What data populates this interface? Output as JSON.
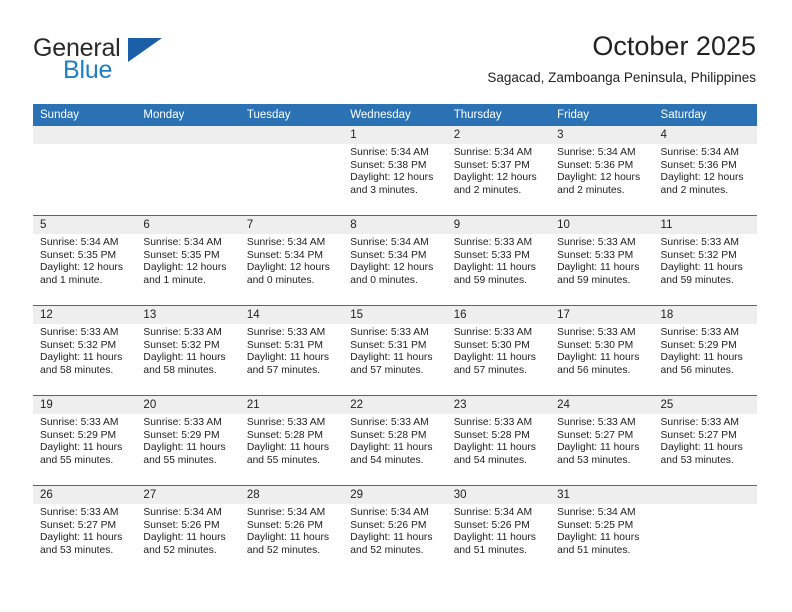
{
  "brand": {
    "word_one": "General",
    "word_two": "Blue",
    "triangle_color": "#1b5fa8",
    "blue_color": "#1f7fc4"
  },
  "header": {
    "title": "October 2025",
    "subtitle": "Sagacad, Zamboanga Peninsula, Philippines"
  },
  "theme": {
    "header_row_bg": "#2b72b5",
    "daynum_bg": "#eeeeee",
    "week_separator": "#2b72b5",
    "text": "#222222"
  },
  "weekdays": [
    "Sunday",
    "Monday",
    "Tuesday",
    "Wednesday",
    "Thursday",
    "Friday",
    "Saturday"
  ],
  "weeks": [
    [
      {
        "day": "",
        "sunrise": "",
        "sunset": "",
        "daylight1": "",
        "daylight2": ""
      },
      {
        "day": "",
        "sunrise": "",
        "sunset": "",
        "daylight1": "",
        "daylight2": ""
      },
      {
        "day": "",
        "sunrise": "",
        "sunset": "",
        "daylight1": "",
        "daylight2": ""
      },
      {
        "day": "1",
        "sunrise": "Sunrise: 5:34 AM",
        "sunset": "Sunset: 5:38 PM",
        "daylight1": "Daylight: 12 hours",
        "daylight2": "and 3 minutes."
      },
      {
        "day": "2",
        "sunrise": "Sunrise: 5:34 AM",
        "sunset": "Sunset: 5:37 PM",
        "daylight1": "Daylight: 12 hours",
        "daylight2": "and 2 minutes."
      },
      {
        "day": "3",
        "sunrise": "Sunrise: 5:34 AM",
        "sunset": "Sunset: 5:36 PM",
        "daylight1": "Daylight: 12 hours",
        "daylight2": "and 2 minutes."
      },
      {
        "day": "4",
        "sunrise": "Sunrise: 5:34 AM",
        "sunset": "Sunset: 5:36 PM",
        "daylight1": "Daylight: 12 hours",
        "daylight2": "and 2 minutes."
      }
    ],
    [
      {
        "day": "5",
        "sunrise": "Sunrise: 5:34 AM",
        "sunset": "Sunset: 5:35 PM",
        "daylight1": "Daylight: 12 hours",
        "daylight2": "and 1 minute."
      },
      {
        "day": "6",
        "sunrise": "Sunrise: 5:34 AM",
        "sunset": "Sunset: 5:35 PM",
        "daylight1": "Daylight: 12 hours",
        "daylight2": "and 1 minute."
      },
      {
        "day": "7",
        "sunrise": "Sunrise: 5:34 AM",
        "sunset": "Sunset: 5:34 PM",
        "daylight1": "Daylight: 12 hours",
        "daylight2": "and 0 minutes."
      },
      {
        "day": "8",
        "sunrise": "Sunrise: 5:34 AM",
        "sunset": "Sunset: 5:34 PM",
        "daylight1": "Daylight: 12 hours",
        "daylight2": "and 0 minutes."
      },
      {
        "day": "9",
        "sunrise": "Sunrise: 5:33 AM",
        "sunset": "Sunset: 5:33 PM",
        "daylight1": "Daylight: 11 hours",
        "daylight2": "and 59 minutes."
      },
      {
        "day": "10",
        "sunrise": "Sunrise: 5:33 AM",
        "sunset": "Sunset: 5:33 PM",
        "daylight1": "Daylight: 11 hours",
        "daylight2": "and 59 minutes."
      },
      {
        "day": "11",
        "sunrise": "Sunrise: 5:33 AM",
        "sunset": "Sunset: 5:32 PM",
        "daylight1": "Daylight: 11 hours",
        "daylight2": "and 59 minutes."
      }
    ],
    [
      {
        "day": "12",
        "sunrise": "Sunrise: 5:33 AM",
        "sunset": "Sunset: 5:32 PM",
        "daylight1": "Daylight: 11 hours",
        "daylight2": "and 58 minutes."
      },
      {
        "day": "13",
        "sunrise": "Sunrise: 5:33 AM",
        "sunset": "Sunset: 5:32 PM",
        "daylight1": "Daylight: 11 hours",
        "daylight2": "and 58 minutes."
      },
      {
        "day": "14",
        "sunrise": "Sunrise: 5:33 AM",
        "sunset": "Sunset: 5:31 PM",
        "daylight1": "Daylight: 11 hours",
        "daylight2": "and 57 minutes."
      },
      {
        "day": "15",
        "sunrise": "Sunrise: 5:33 AM",
        "sunset": "Sunset: 5:31 PM",
        "daylight1": "Daylight: 11 hours",
        "daylight2": "and 57 minutes."
      },
      {
        "day": "16",
        "sunrise": "Sunrise: 5:33 AM",
        "sunset": "Sunset: 5:30 PM",
        "daylight1": "Daylight: 11 hours",
        "daylight2": "and 57 minutes."
      },
      {
        "day": "17",
        "sunrise": "Sunrise: 5:33 AM",
        "sunset": "Sunset: 5:30 PM",
        "daylight1": "Daylight: 11 hours",
        "daylight2": "and 56 minutes."
      },
      {
        "day": "18",
        "sunrise": "Sunrise: 5:33 AM",
        "sunset": "Sunset: 5:29 PM",
        "daylight1": "Daylight: 11 hours",
        "daylight2": "and 56 minutes."
      }
    ],
    [
      {
        "day": "19",
        "sunrise": "Sunrise: 5:33 AM",
        "sunset": "Sunset: 5:29 PM",
        "daylight1": "Daylight: 11 hours",
        "daylight2": "and 55 minutes."
      },
      {
        "day": "20",
        "sunrise": "Sunrise: 5:33 AM",
        "sunset": "Sunset: 5:29 PM",
        "daylight1": "Daylight: 11 hours",
        "daylight2": "and 55 minutes."
      },
      {
        "day": "21",
        "sunrise": "Sunrise: 5:33 AM",
        "sunset": "Sunset: 5:28 PM",
        "daylight1": "Daylight: 11 hours",
        "daylight2": "and 55 minutes."
      },
      {
        "day": "22",
        "sunrise": "Sunrise: 5:33 AM",
        "sunset": "Sunset: 5:28 PM",
        "daylight1": "Daylight: 11 hours",
        "daylight2": "and 54 minutes."
      },
      {
        "day": "23",
        "sunrise": "Sunrise: 5:33 AM",
        "sunset": "Sunset: 5:28 PM",
        "daylight1": "Daylight: 11 hours",
        "daylight2": "and 54 minutes."
      },
      {
        "day": "24",
        "sunrise": "Sunrise: 5:33 AM",
        "sunset": "Sunset: 5:27 PM",
        "daylight1": "Daylight: 11 hours",
        "daylight2": "and 53 minutes."
      },
      {
        "day": "25",
        "sunrise": "Sunrise: 5:33 AM",
        "sunset": "Sunset: 5:27 PM",
        "daylight1": "Daylight: 11 hours",
        "daylight2": "and 53 minutes."
      }
    ],
    [
      {
        "day": "26",
        "sunrise": "Sunrise: 5:33 AM",
        "sunset": "Sunset: 5:27 PM",
        "daylight1": "Daylight: 11 hours",
        "daylight2": "and 53 minutes."
      },
      {
        "day": "27",
        "sunrise": "Sunrise: 5:34 AM",
        "sunset": "Sunset: 5:26 PM",
        "daylight1": "Daylight: 11 hours",
        "daylight2": "and 52 minutes."
      },
      {
        "day": "28",
        "sunrise": "Sunrise: 5:34 AM",
        "sunset": "Sunset: 5:26 PM",
        "daylight1": "Daylight: 11 hours",
        "daylight2": "and 52 minutes."
      },
      {
        "day": "29",
        "sunrise": "Sunrise: 5:34 AM",
        "sunset": "Sunset: 5:26 PM",
        "daylight1": "Daylight: 11 hours",
        "daylight2": "and 52 minutes."
      },
      {
        "day": "30",
        "sunrise": "Sunrise: 5:34 AM",
        "sunset": "Sunset: 5:26 PM",
        "daylight1": "Daylight: 11 hours",
        "daylight2": "and 51 minutes."
      },
      {
        "day": "31",
        "sunrise": "Sunrise: 5:34 AM",
        "sunset": "Sunset: 5:25 PM",
        "daylight1": "Daylight: 11 hours",
        "daylight2": "and 51 minutes."
      },
      {
        "day": "",
        "sunrise": "",
        "sunset": "",
        "daylight1": "",
        "daylight2": ""
      }
    ]
  ]
}
